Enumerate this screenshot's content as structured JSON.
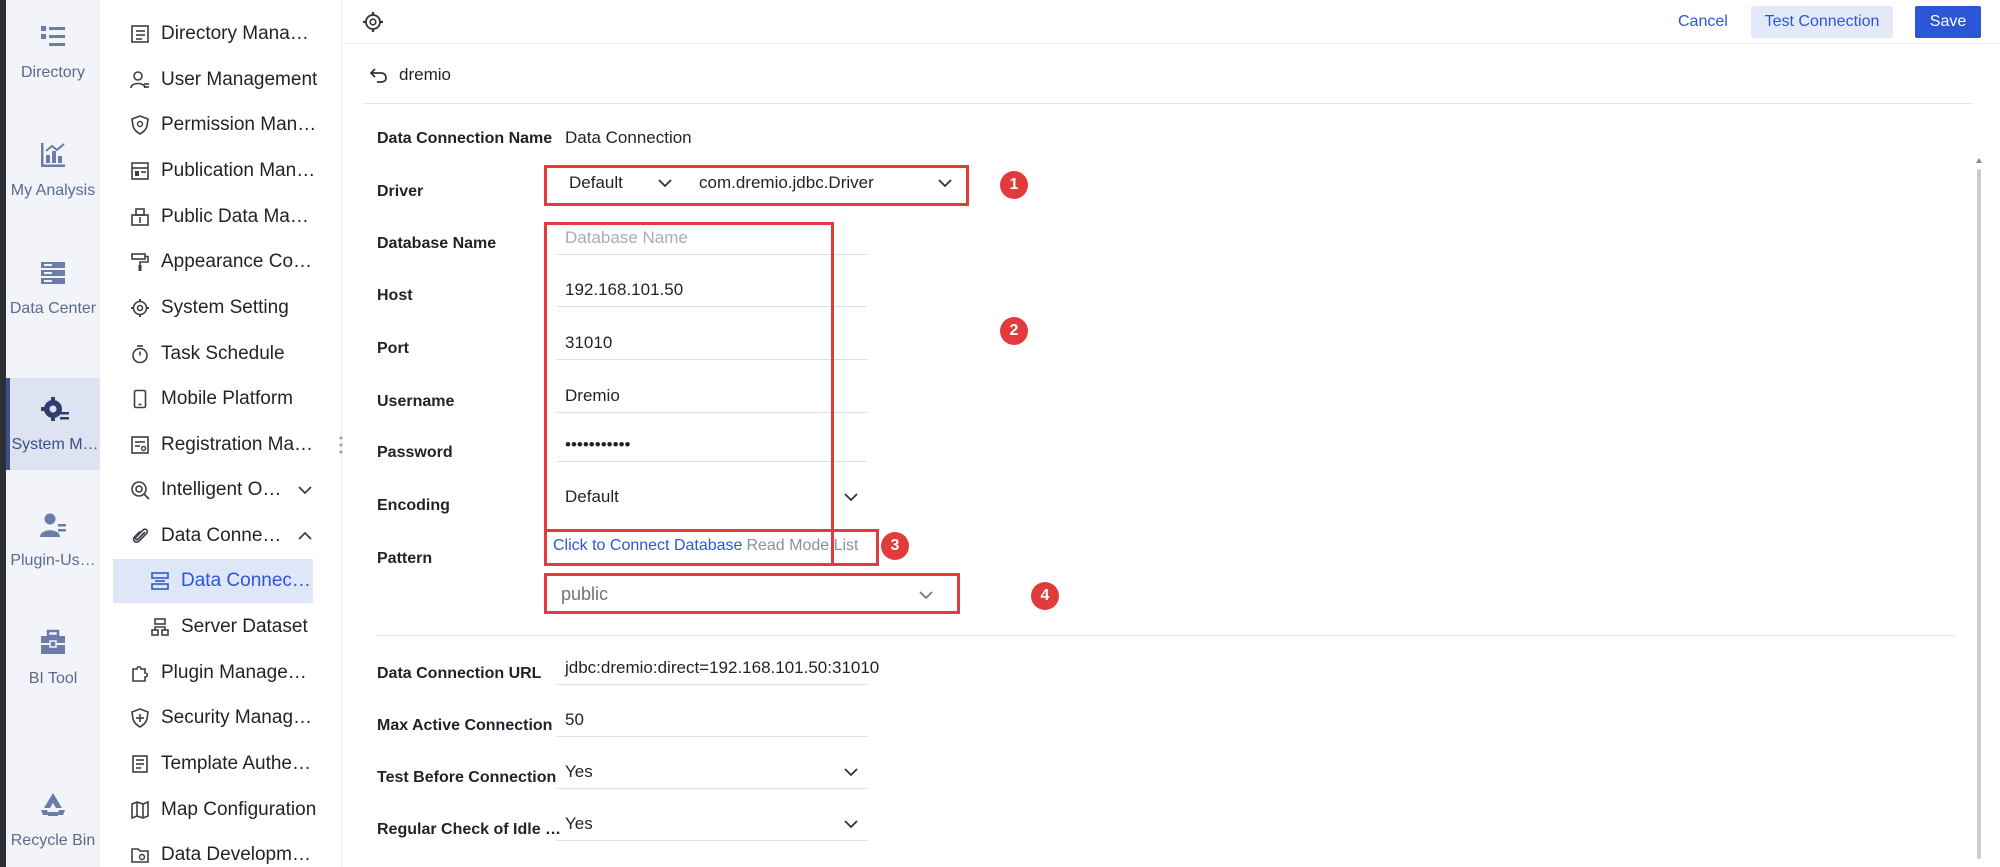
{
  "rail": {
    "items": [
      {
        "label": "Directory",
        "icon": "directory-icon"
      },
      {
        "label": "My Analysis",
        "icon": "analysis-chart-icon"
      },
      {
        "label": "Data Center",
        "icon": "data-center-icon"
      },
      {
        "label": "System M…",
        "icon": "system-gear-icon"
      },
      {
        "label": "Plugin-Us…",
        "icon": "plugin-user-icon"
      },
      {
        "label": "BI Tool",
        "icon": "toolbox-icon"
      },
      {
        "label": "Recycle Bin",
        "icon": "recycle-icon"
      }
    ]
  },
  "menu": {
    "items": [
      {
        "label": "Directory Mana…"
      },
      {
        "label": "User Management"
      },
      {
        "label": "Permission Man…"
      },
      {
        "label": "Publication Man…"
      },
      {
        "label": "Public Data Ma…"
      },
      {
        "label": "Appearance Co…"
      },
      {
        "label": "System Setting"
      },
      {
        "label": "Task Schedule"
      },
      {
        "label": "Mobile Platform"
      },
      {
        "label": "Registration Ma…"
      },
      {
        "label": "Intelligent O…"
      },
      {
        "label": "Data Conne…"
      },
      {
        "label": "Data Connect…"
      },
      {
        "label": "Server Dataset"
      },
      {
        "label": "Plugin Manage…"
      },
      {
        "label": "Security Manag…"
      },
      {
        "label": "Template Authe…"
      },
      {
        "label": "Map Configuration"
      },
      {
        "label": "Data Developm…"
      }
    ]
  },
  "topbar": {
    "cancel_label": "Cancel",
    "test_label": "Test Connection",
    "save_label": "Save"
  },
  "breadcrumb": {
    "back_label": "dremio"
  },
  "form": {
    "connection_name": {
      "label": "Data Connection Name",
      "value": "Data Connection"
    },
    "driver": {
      "label": "Driver",
      "type_value": "Default",
      "class_value": "com.dremio.jdbc.Driver"
    },
    "database_name": {
      "label": "Database Name",
      "placeholder": "Database Name"
    },
    "host": {
      "label": "Host",
      "value": "192.168.101.50"
    },
    "port": {
      "label": "Port",
      "value": "31010"
    },
    "username": {
      "label": "Username",
      "value": "Dremio"
    },
    "password": {
      "label": "Password",
      "value": "•••••••••••"
    },
    "encoding": {
      "label": "Encoding",
      "value": "Default"
    },
    "pattern": {
      "label": "Pattern",
      "connect_link": "Click to Connect Database",
      "read_mode": "Read Mode List",
      "value": "public"
    },
    "url": {
      "label": "Data Connection URL",
      "value": "jdbc:dremio:direct=192.168.101.50:31010"
    },
    "max_active": {
      "label": "Max Active Connection",
      "value": "50"
    },
    "test_before": {
      "label": "Test Before Connection",
      "value": "Yes"
    },
    "regular_check": {
      "label": "Regular Check of Idle …",
      "value": "Yes"
    }
  },
  "annotations": {
    "one": "1",
    "two": "2",
    "three": "3",
    "four": "4"
  },
  "colors": {
    "accent": "#2b57d6",
    "annotation": "#e23b3b",
    "rail_bg": "#f2f4f9",
    "selected_bg": "#dfe6f7"
  }
}
